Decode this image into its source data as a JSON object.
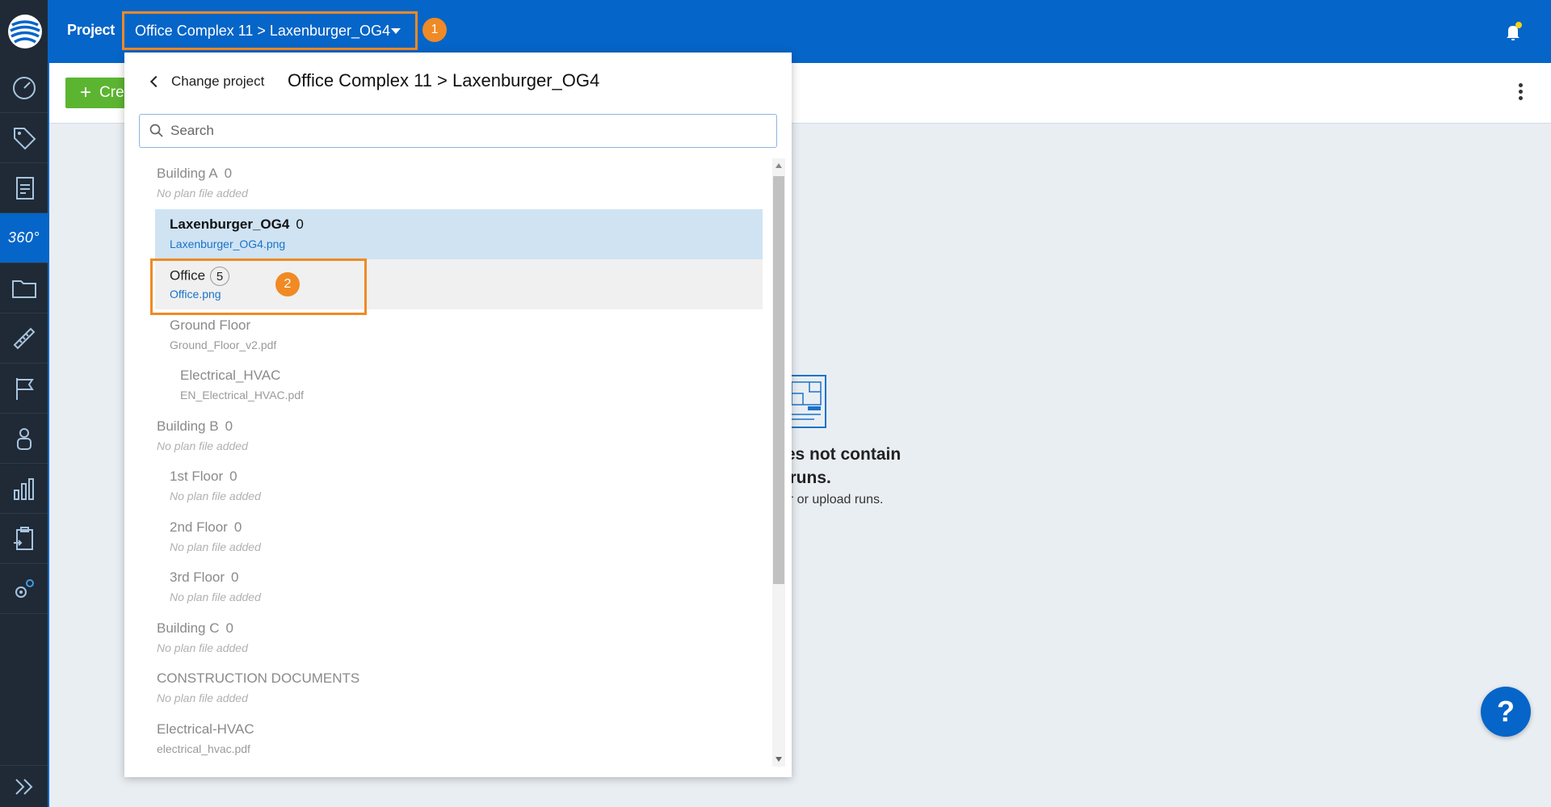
{
  "topbar": {
    "project_label": "Project",
    "project_selector": "Office Complex 11 > Laxenburger_OG4",
    "badge1": "1"
  },
  "sidebar": {
    "items": [
      {
        "icon": "speedometer-icon"
      },
      {
        "icon": "tags-icon"
      },
      {
        "icon": "report-icon"
      },
      {
        "icon": "360-view-icon",
        "label": "360°",
        "active": true
      },
      {
        "icon": "folder-icon"
      },
      {
        "icon": "ruler-pencil-icon"
      },
      {
        "icon": "flag-icon"
      },
      {
        "icon": "user-icon"
      },
      {
        "icon": "bar-chart-icon"
      },
      {
        "icon": "clipboard-icon"
      },
      {
        "icon": "settings-gears-icon"
      }
    ],
    "expand_icon": "double-chevron-right-icon"
  },
  "subbar": {
    "create_label": "Cre"
  },
  "dropdown": {
    "back_label": "Change project",
    "title": "Office Complex 11 > Laxenburger_OG4",
    "search_placeholder": "Search",
    "badge2": "2",
    "items": [
      {
        "name": "Building A",
        "count": "0",
        "file": "No plan file added",
        "state": "plain"
      },
      {
        "name": "Laxenburger_OG4",
        "count": "0",
        "file": "Laxenburger_OG4.png",
        "state": "selected"
      },
      {
        "name": "Office",
        "count": "5",
        "file": "Office.png",
        "state": "hover"
      },
      {
        "name": "Ground Floor",
        "count": "",
        "file": "Ground_Floor_v2.pdf",
        "state": "plain"
      },
      {
        "name": "Electrical_HVAC",
        "count": "",
        "file": "EN_Electrical_HVAC.pdf",
        "state": "plain"
      },
      {
        "name": "Building B",
        "count": "0",
        "file": "No plan file added",
        "state": "plain"
      },
      {
        "name": "1st Floor",
        "count": "0",
        "file": "No plan file added",
        "state": "plain"
      },
      {
        "name": "2nd Floor",
        "count": "0",
        "file": "No plan file added",
        "state": "plain"
      },
      {
        "name": "3rd Floor",
        "count": "0",
        "file": "No plan file added",
        "state": "plain"
      },
      {
        "name": "Building C",
        "count": "0",
        "file": "No plan file added",
        "state": "plain"
      },
      {
        "name": "CONSTRUCTION DOCUMENTS",
        "count": "",
        "file": "No plan file added",
        "state": "plain"
      },
      {
        "name": "Electrical-HVAC",
        "count": "",
        "file": "electrical_hvac.pdf",
        "state": "plain"
      }
    ]
  },
  "empty_state": {
    "title_line1": "oes not contain",
    "title_line2": "y runs.",
    "subtitle": "ver or upload runs."
  },
  "help_label": "?",
  "colors": {
    "brand_blue": "#0565c8",
    "rail_dark": "#1f2a36",
    "accent_orange": "#f08a24",
    "create_green": "#5cb531"
  }
}
